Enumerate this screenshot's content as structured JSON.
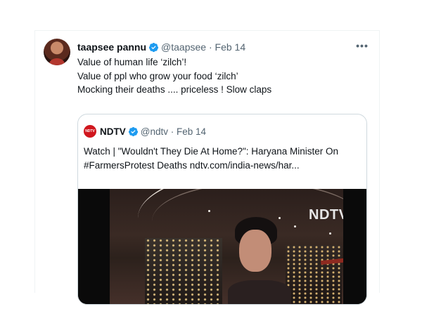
{
  "tweet": {
    "author_name": "taapsee pannu",
    "handle": "@taapsee",
    "separator": "·",
    "date": "Feb 14",
    "more_label": "•••",
    "lines": [
      "Value of human life ‘zilch’!",
      "Value of ppl who grow your food ‘zilch’",
      "Mocking their deaths .... priceless ! Slow claps"
    ]
  },
  "quoted_tweet": {
    "avatar_label": "NDTV",
    "author_name": "NDTV",
    "handle": "@ndtv",
    "separator": "·",
    "date": "Feb 14",
    "lines": [
      "Watch | \"Wouldn't They Die At Home?\": Haryana Minister On",
      "#FarmersProtest Deaths ndtv.com/india-news/har..."
    ],
    "video": {
      "watermark": "NDTV"
    }
  },
  "colors": {
    "verified": "#1d9bf0",
    "muted_text": "#536471",
    "ndtv_red": "#d0161d",
    "border": "#cfd9de"
  },
  "icons": {
    "verified": "verified-badge-icon",
    "more": "more-options-icon"
  }
}
